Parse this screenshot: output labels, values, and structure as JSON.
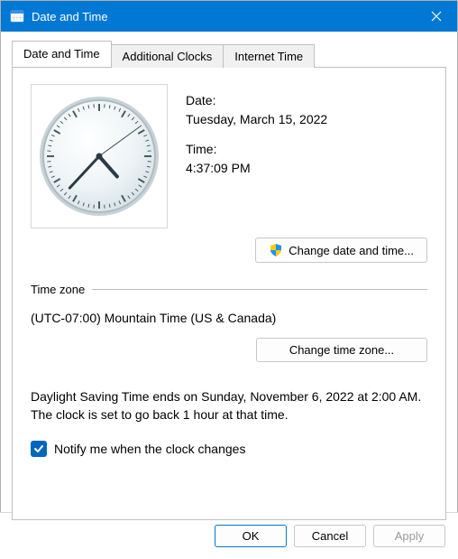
{
  "window": {
    "title": "Date and Time"
  },
  "tabs": [
    {
      "label": "Date and Time",
      "active": true
    },
    {
      "label": "Additional Clocks",
      "active": false
    },
    {
      "label": "Internet Time",
      "active": false
    }
  ],
  "datetime": {
    "date_label": "Date:",
    "date_value": "Tuesday, March 15, 2022",
    "time_label": "Time:",
    "time_value": "4:37:09 PM",
    "change_datetime_label": "Change date and time...",
    "clock_hour": 4,
    "clock_minute": 37,
    "clock_second": 9
  },
  "timezone": {
    "section_label": "Time zone",
    "current": "(UTC-07:00) Mountain Time (US & Canada)",
    "change_tz_label": "Change time zone..."
  },
  "dst": {
    "text": "Daylight Saving Time ends on Sunday, November 6, 2022 at 2:00 AM. The clock is set to go back 1 hour at that time.",
    "notify_label": "Notify me when the clock changes",
    "notify_checked": true
  },
  "footer": {
    "ok": "OK",
    "cancel": "Cancel",
    "apply": "Apply",
    "apply_enabled": false
  },
  "colors": {
    "accent": "#0078d4",
    "checkbox": "#0067c0"
  }
}
